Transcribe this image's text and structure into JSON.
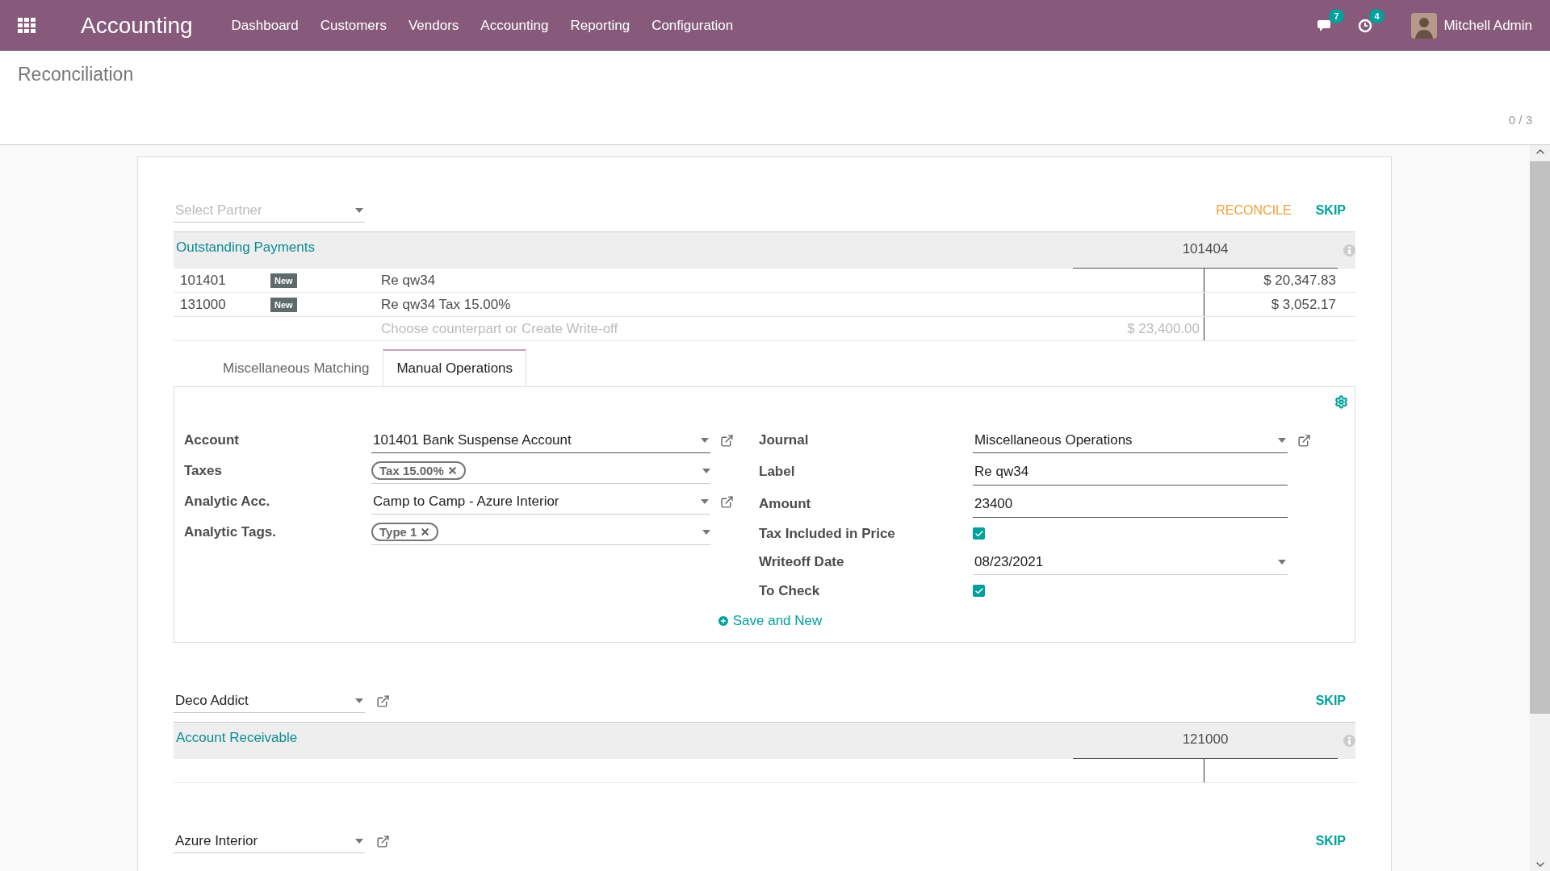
{
  "navbar": {
    "app_title": "Accounting",
    "menu": [
      "Dashboard",
      "Customers",
      "Vendors",
      "Accounting",
      "Reporting",
      "Configuration"
    ],
    "messages_count": "7",
    "activities_count": "4",
    "user": "Mitchell Admin"
  },
  "breadcrumb": "Reconciliation",
  "pager": "0 / 3",
  "statements": [
    {
      "partner": {
        "placeholder": "Select Partner",
        "link": false
      },
      "actions": [
        {
          "label": "RECONCILE",
          "kind": "reconcile"
        },
        {
          "label": "SKIP",
          "kind": "skip"
        }
      ],
      "account_label": "Outstanding Payments",
      "account_code": "101404",
      "lines": [
        {
          "account": "101401",
          "badge": "New",
          "label": "Re qw34",
          "amount": "$ 20,347.83"
        },
        {
          "account": "131000",
          "badge": "New",
          "label": "Re qw34 Tax 15.00%",
          "amount": "$ 3,052.17"
        }
      ],
      "counterpart_hint": "Choose counterpart or Create Write-off",
      "counterpart_total": "$ 23,400.00",
      "tabs": [
        {
          "label": "Miscellaneous Matching",
          "selected": false
        },
        {
          "label": "Manual Operations",
          "selected": true
        }
      ],
      "manual": {
        "left": [
          {
            "label": "Account",
            "kind": "select",
            "value": "101401 Bank Suspense Account",
            "link": true
          },
          {
            "label": "Taxes",
            "kind": "tags",
            "tags": [
              "Tax 15.00%"
            ],
            "link": false
          },
          {
            "label": "Analytic Acc.",
            "kind": "select",
            "value": "Camp to Camp - Azure Interior",
            "link": true
          },
          {
            "label": "Analytic Tags.",
            "kind": "tags",
            "tags": [
              "Type 1"
            ],
            "link": false
          }
        ],
        "right": [
          {
            "label": "Journal",
            "kind": "select",
            "value": "Miscellaneous Operations",
            "link": true
          },
          {
            "label": "Label",
            "kind": "input",
            "value": "Re qw34"
          },
          {
            "label": "Amount",
            "kind": "input",
            "value": "23400"
          },
          {
            "label": "Tax Included in Price",
            "kind": "checkbox",
            "checked": true
          },
          {
            "label": "Writeoff Date",
            "kind": "select",
            "value": "08/23/2021",
            "link": false
          },
          {
            "label": "To Check",
            "kind": "checkbox",
            "checked": true
          }
        ],
        "save_label": "Save and New"
      }
    },
    {
      "partner": {
        "value": "Deco Addict",
        "link": true
      },
      "actions": [
        {
          "label": "SKIP",
          "kind": "skip"
        }
      ],
      "account_label": "Account Receivable",
      "account_code": "121000"
    },
    {
      "partner": {
        "value": "Azure Interior",
        "link": true
      },
      "actions": [
        {
          "label": "SKIP",
          "kind": "skip"
        }
      ]
    }
  ]
}
